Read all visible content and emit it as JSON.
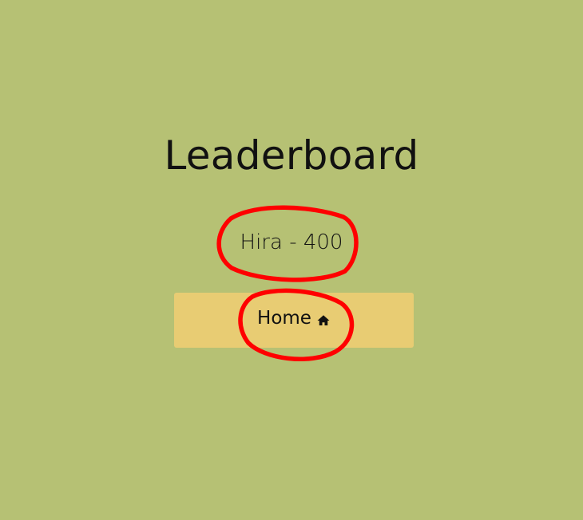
{
  "page": {
    "title": "Leaderboard"
  },
  "leaderboard": {
    "entry_text": "Hira - 400"
  },
  "home_button": {
    "label": "Home",
    "icon": "home-icon"
  },
  "colors": {
    "background": "#b6c174",
    "button": "#e8cc73",
    "annotation": "#ff0000",
    "text": "#111111"
  }
}
